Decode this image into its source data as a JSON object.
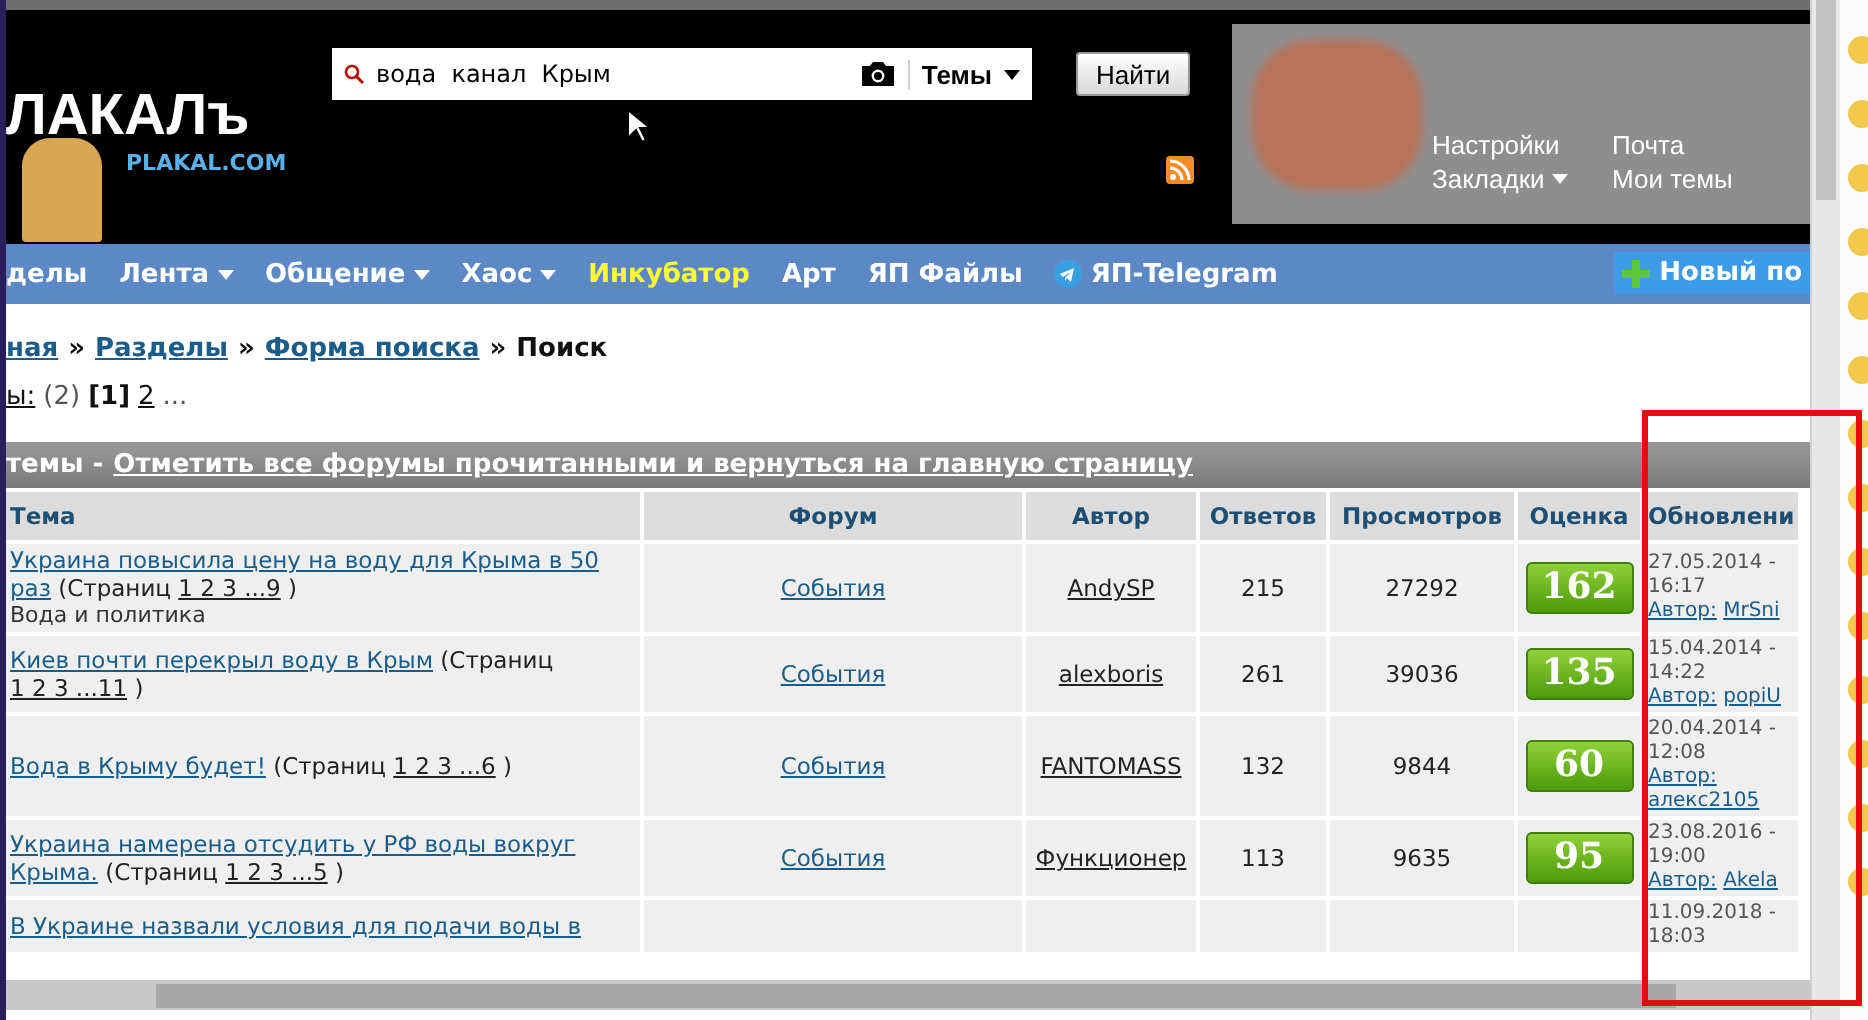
{
  "header": {
    "logo": "ЛАКАЛъ",
    "logo_domain": "PLAKAL.COM",
    "search": {
      "value": "вода  канал  Крым",
      "scope": "Темы"
    },
    "search_button": "Найти",
    "user_links": [
      {
        "label": "Настройки",
        "dropdown": false
      },
      {
        "label": "Почта",
        "dropdown": false
      },
      {
        "label": "Закладки",
        "dropdown": true
      },
      {
        "label": "Мои темы",
        "dropdown": false
      }
    ]
  },
  "nav": {
    "items": [
      {
        "label": "делы",
        "dropdown": false,
        "highlight": false,
        "kind": "text"
      },
      {
        "label": "Лента",
        "dropdown": true,
        "highlight": false,
        "kind": "text"
      },
      {
        "label": "Общение",
        "dropdown": true,
        "highlight": false,
        "kind": "text"
      },
      {
        "label": "Хаос",
        "dropdown": true,
        "highlight": false,
        "kind": "text"
      },
      {
        "label": "Инкубатор",
        "dropdown": false,
        "highlight": true,
        "kind": "text"
      },
      {
        "label": "Арт",
        "dropdown": false,
        "highlight": false,
        "kind": "text"
      },
      {
        "label": "ЯП Файлы",
        "dropdown": false,
        "highlight": false,
        "kind": "text"
      },
      {
        "label": "ЯП-Telegram",
        "dropdown": false,
        "highlight": false,
        "kind": "telegram"
      }
    ],
    "new_topic": "Новый по"
  },
  "breadcrumb": [
    {
      "label": "ная",
      "link": true
    },
    {
      "label": "»",
      "link": false
    },
    {
      "label": "Разделы",
      "link": true
    },
    {
      "label": "»",
      "link": false
    },
    {
      "label": "Форма поиска",
      "link": true
    },
    {
      "label": "»",
      "link": false
    },
    {
      "label": "Поиск",
      "link": false
    }
  ],
  "pagination": [
    {
      "label": "ы:",
      "kind": "link"
    },
    {
      "label": "(2)",
      "kind": "count"
    },
    {
      "label": "[1]",
      "kind": "current"
    },
    {
      "label": "2",
      "kind": "link"
    },
    {
      "label": "...",
      "kind": "more"
    }
  ],
  "topics_bar": {
    "label": "темы -",
    "link": "Отметить все форумы прочитанными и вернуться на главную страницу"
  },
  "table": {
    "columns": [
      "Тема",
      "Форум",
      "Автор",
      "Ответов",
      "Просмотров",
      "Оценка",
      "Обновлени"
    ],
    "rows": [
      {
        "topic": [
          {
            "kind": "title",
            "text": "Украина повысила цену на воду для Крыма в 50 раз"
          },
          {
            "kind": "plain",
            "text": "(Страниц"
          },
          {
            "kind": "pages",
            "text": "1 2 3 ...9"
          },
          {
            "kind": "plain",
            "text": ")"
          }
        ],
        "description": "Вода и политика",
        "forum": "События",
        "author": "AndySP",
        "replies": "215",
        "views": "27292",
        "rating": "162",
        "updated_date": "27.05.2014 -",
        "updated_time": "16:17",
        "updated_author_label": "Автор:",
        "updated_author": "MrSni"
      },
      {
        "topic": [
          {
            "kind": "title",
            "text": "Киев почти перекрыл воду в Крым"
          },
          {
            "kind": "plain",
            "text": "(Страниц"
          },
          {
            "kind": "pages",
            "text": "1 2 3 ...11"
          },
          {
            "kind": "plain",
            "text": ")"
          }
        ],
        "forum": "События",
        "author": "alexboris",
        "replies": "261",
        "views": "39036",
        "rating": "135",
        "updated_date": "15.04.2014 -",
        "updated_time": "14:22",
        "updated_author_label": "Автор:",
        "updated_author": "popiU"
      },
      {
        "topic": [
          {
            "kind": "title",
            "text": "Вода в Крыму будет!"
          },
          {
            "kind": "plain",
            "text": "(Страниц"
          },
          {
            "kind": "pages",
            "text": "1 2 3 ...6"
          },
          {
            "kind": "plain",
            "text": ")"
          }
        ],
        "forum": "События",
        "author": "FANTOMASS",
        "replies": "132",
        "views": "9844",
        "rating": "60",
        "updated_date": "20.04.2014 -",
        "updated_time": "12:08",
        "updated_author_label": "Автор:",
        "updated_author": "алекс2105"
      },
      {
        "topic": [
          {
            "kind": "title",
            "text": "Украина намерена отсудить у РФ воды вокруг Крыма."
          },
          {
            "kind": "plain",
            "text": "(Страниц"
          },
          {
            "kind": "pages",
            "text": "1 2 3 ...5"
          },
          {
            "kind": "plain",
            "text": ")"
          }
        ],
        "forum": "События",
        "author": "Функционер",
        "replies": "113",
        "views": "9635",
        "rating": "95",
        "updated_date": "23.08.2016 -",
        "updated_time": "19:00",
        "updated_author_label": "Автор:",
        "updated_author": "Akela"
      },
      {
        "topic": [
          {
            "kind": "title",
            "text": "В Украине назвали условия для подачи воды в"
          }
        ],
        "updated_date": "11.09.2018 -",
        "updated_time": "18:03"
      }
    ]
  }
}
